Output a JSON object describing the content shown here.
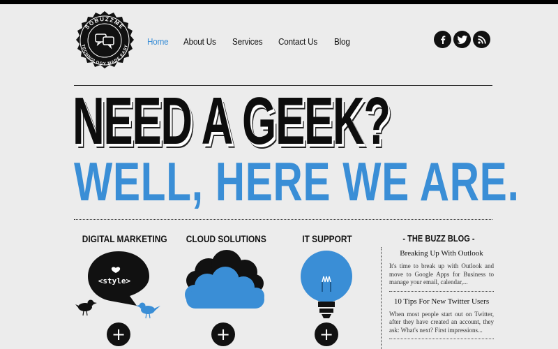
{
  "brand": {
    "ring_top": "SOBUZZME",
    "ring_bottom": "TECHNOLOGY MADE EASY"
  },
  "nav": {
    "items": [
      {
        "label": "Home",
        "active": true
      },
      {
        "label": "About Us",
        "active": false
      },
      {
        "label": "Services",
        "active": false
      },
      {
        "label": "Contact Us",
        "active": false
      },
      {
        "label": "Blog",
        "active": false
      }
    ]
  },
  "social": {
    "icons": [
      "facebook-icon",
      "twitter-icon",
      "rss-icon"
    ]
  },
  "hero": {
    "line1": "NEED A GEEK?",
    "line2": "WELL, HERE WE ARE."
  },
  "features": [
    {
      "title": "DIGITAL MARKETING",
      "bubble_text": "<style>",
      "icon": "speech-bubble-birds-icon"
    },
    {
      "title": "CLOUD SOLUTIONS",
      "icon": "cloud-icon"
    },
    {
      "title": "IT SUPPORT",
      "icon": "lightbulb-icon"
    }
  ],
  "plus_label": "+",
  "blog": {
    "title": "- THE BUZZ BLOG -",
    "posts": [
      {
        "title": "Breaking Up With Outlook",
        "excerpt": "It's time to break up with Outlook and move to Google Apps for Business to manage your email, calendar,..."
      },
      {
        "title": "10 Tips For New Twitter Users",
        "excerpt": "When most people start out on Twitter, after they have created an account, they ask: What's next? First impressions..."
      }
    ]
  },
  "colors": {
    "accent": "#3a8ed6",
    "background": "#ececec",
    "dark": "#111111"
  }
}
